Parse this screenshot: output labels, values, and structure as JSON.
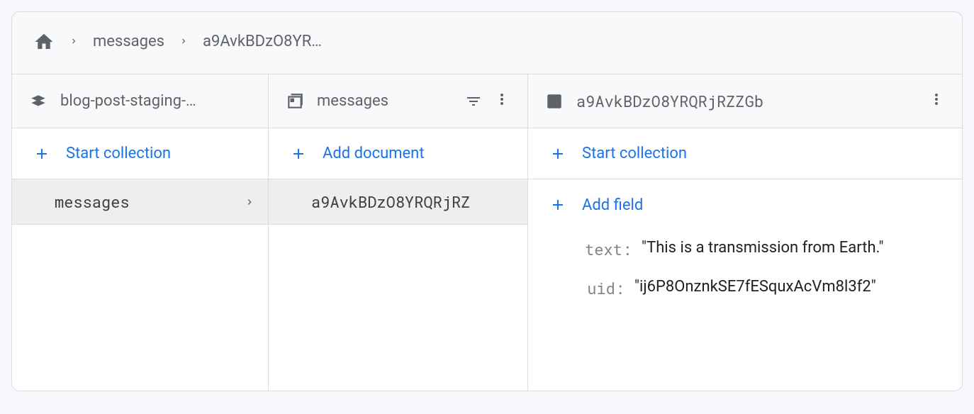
{
  "breadcrumb": {
    "collection": "messages",
    "document_truncated": "a9AvkBDzO8YR…"
  },
  "column1": {
    "project_name": "blog-post-staging-…",
    "action_label": "Start collection",
    "items": [
      {
        "name": "messages"
      }
    ]
  },
  "column2": {
    "collection_name": "messages",
    "action_label": "Add document",
    "items": [
      {
        "id_truncated": "a9AvkBDzO8YRQRjRZ"
      }
    ]
  },
  "column3": {
    "document_id": "a9AvkBDzO8YRQRjRZZGb",
    "action_start_collection": "Start collection",
    "action_add_field": "Add field",
    "fields": [
      {
        "key": "text",
        "value": "\"This is a transmission from Earth.\""
      },
      {
        "key": "uid",
        "value": "\"ij6P8OnznkSE7fESquxAcVm8l3f2\""
      }
    ]
  }
}
